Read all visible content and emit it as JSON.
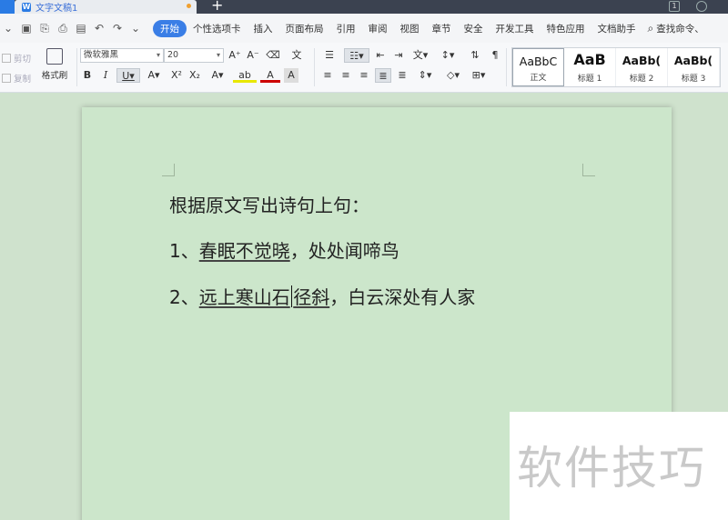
{
  "window": {
    "tab_title": "文字文稿1",
    "new_tab": "+"
  },
  "menu": {
    "items": [
      "开始",
      "个性选项卡",
      "插入",
      "页面布局",
      "引用",
      "审阅",
      "视图",
      "章节",
      "安全",
      "开发工具",
      "特色应用",
      "文档助手"
    ],
    "active": "开始",
    "search": "查找命令、"
  },
  "ribbon": {
    "cut": "剪切",
    "copy": "复制",
    "format_painter": "格式刷",
    "font_name": "微软雅黑",
    "font_size": "20",
    "styles": [
      {
        "sample": "AaBbC",
        "name": "正文"
      },
      {
        "sample": "AaB",
        "name": "标题 1"
      },
      {
        "sample": "AaBb(",
        "name": "标题 2"
      },
      {
        "sample": "AaBb(",
        "name": "标题 3"
      }
    ]
  },
  "document": {
    "line1": "根据原文写出诗句上句：",
    "line2_prefix": "1、",
    "line2_underlined": "春眠不觉晓",
    "line2_suffix": "，处处闻啼鸟",
    "line3_prefix": "2、",
    "line3_underlined_a": "远上寒山石",
    "line3_underlined_b": "径斜",
    "line3_suffix": "，白云深处有人家"
  },
  "watermark": {
    "text": "软件技巧"
  }
}
